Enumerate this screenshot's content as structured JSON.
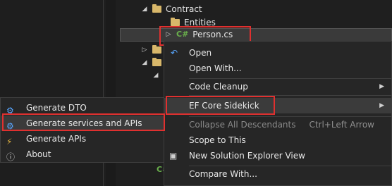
{
  "tree": {
    "contract": "Contract",
    "entities": "Entities",
    "file": "Person.cs",
    "file_icon": "C#"
  },
  "context_menu": {
    "items": [
      {
        "label": "Open"
      },
      {
        "label": "Open With..."
      },
      {
        "label": "Code Cleanup"
      },
      {
        "label": "EF Core Sidekick"
      },
      {
        "label": "Collapse All Descendants",
        "shortcut": "Ctrl+Left Arrow"
      },
      {
        "label": "Scope to This"
      },
      {
        "label": "New Solution Explorer View"
      },
      {
        "label": "Compare With..."
      }
    ]
  },
  "submenu": {
    "items": [
      {
        "label": "Generate DTO"
      },
      {
        "label": "Generate services and APIs"
      },
      {
        "label": "Generate APIs"
      },
      {
        "label": "About"
      }
    ]
  }
}
